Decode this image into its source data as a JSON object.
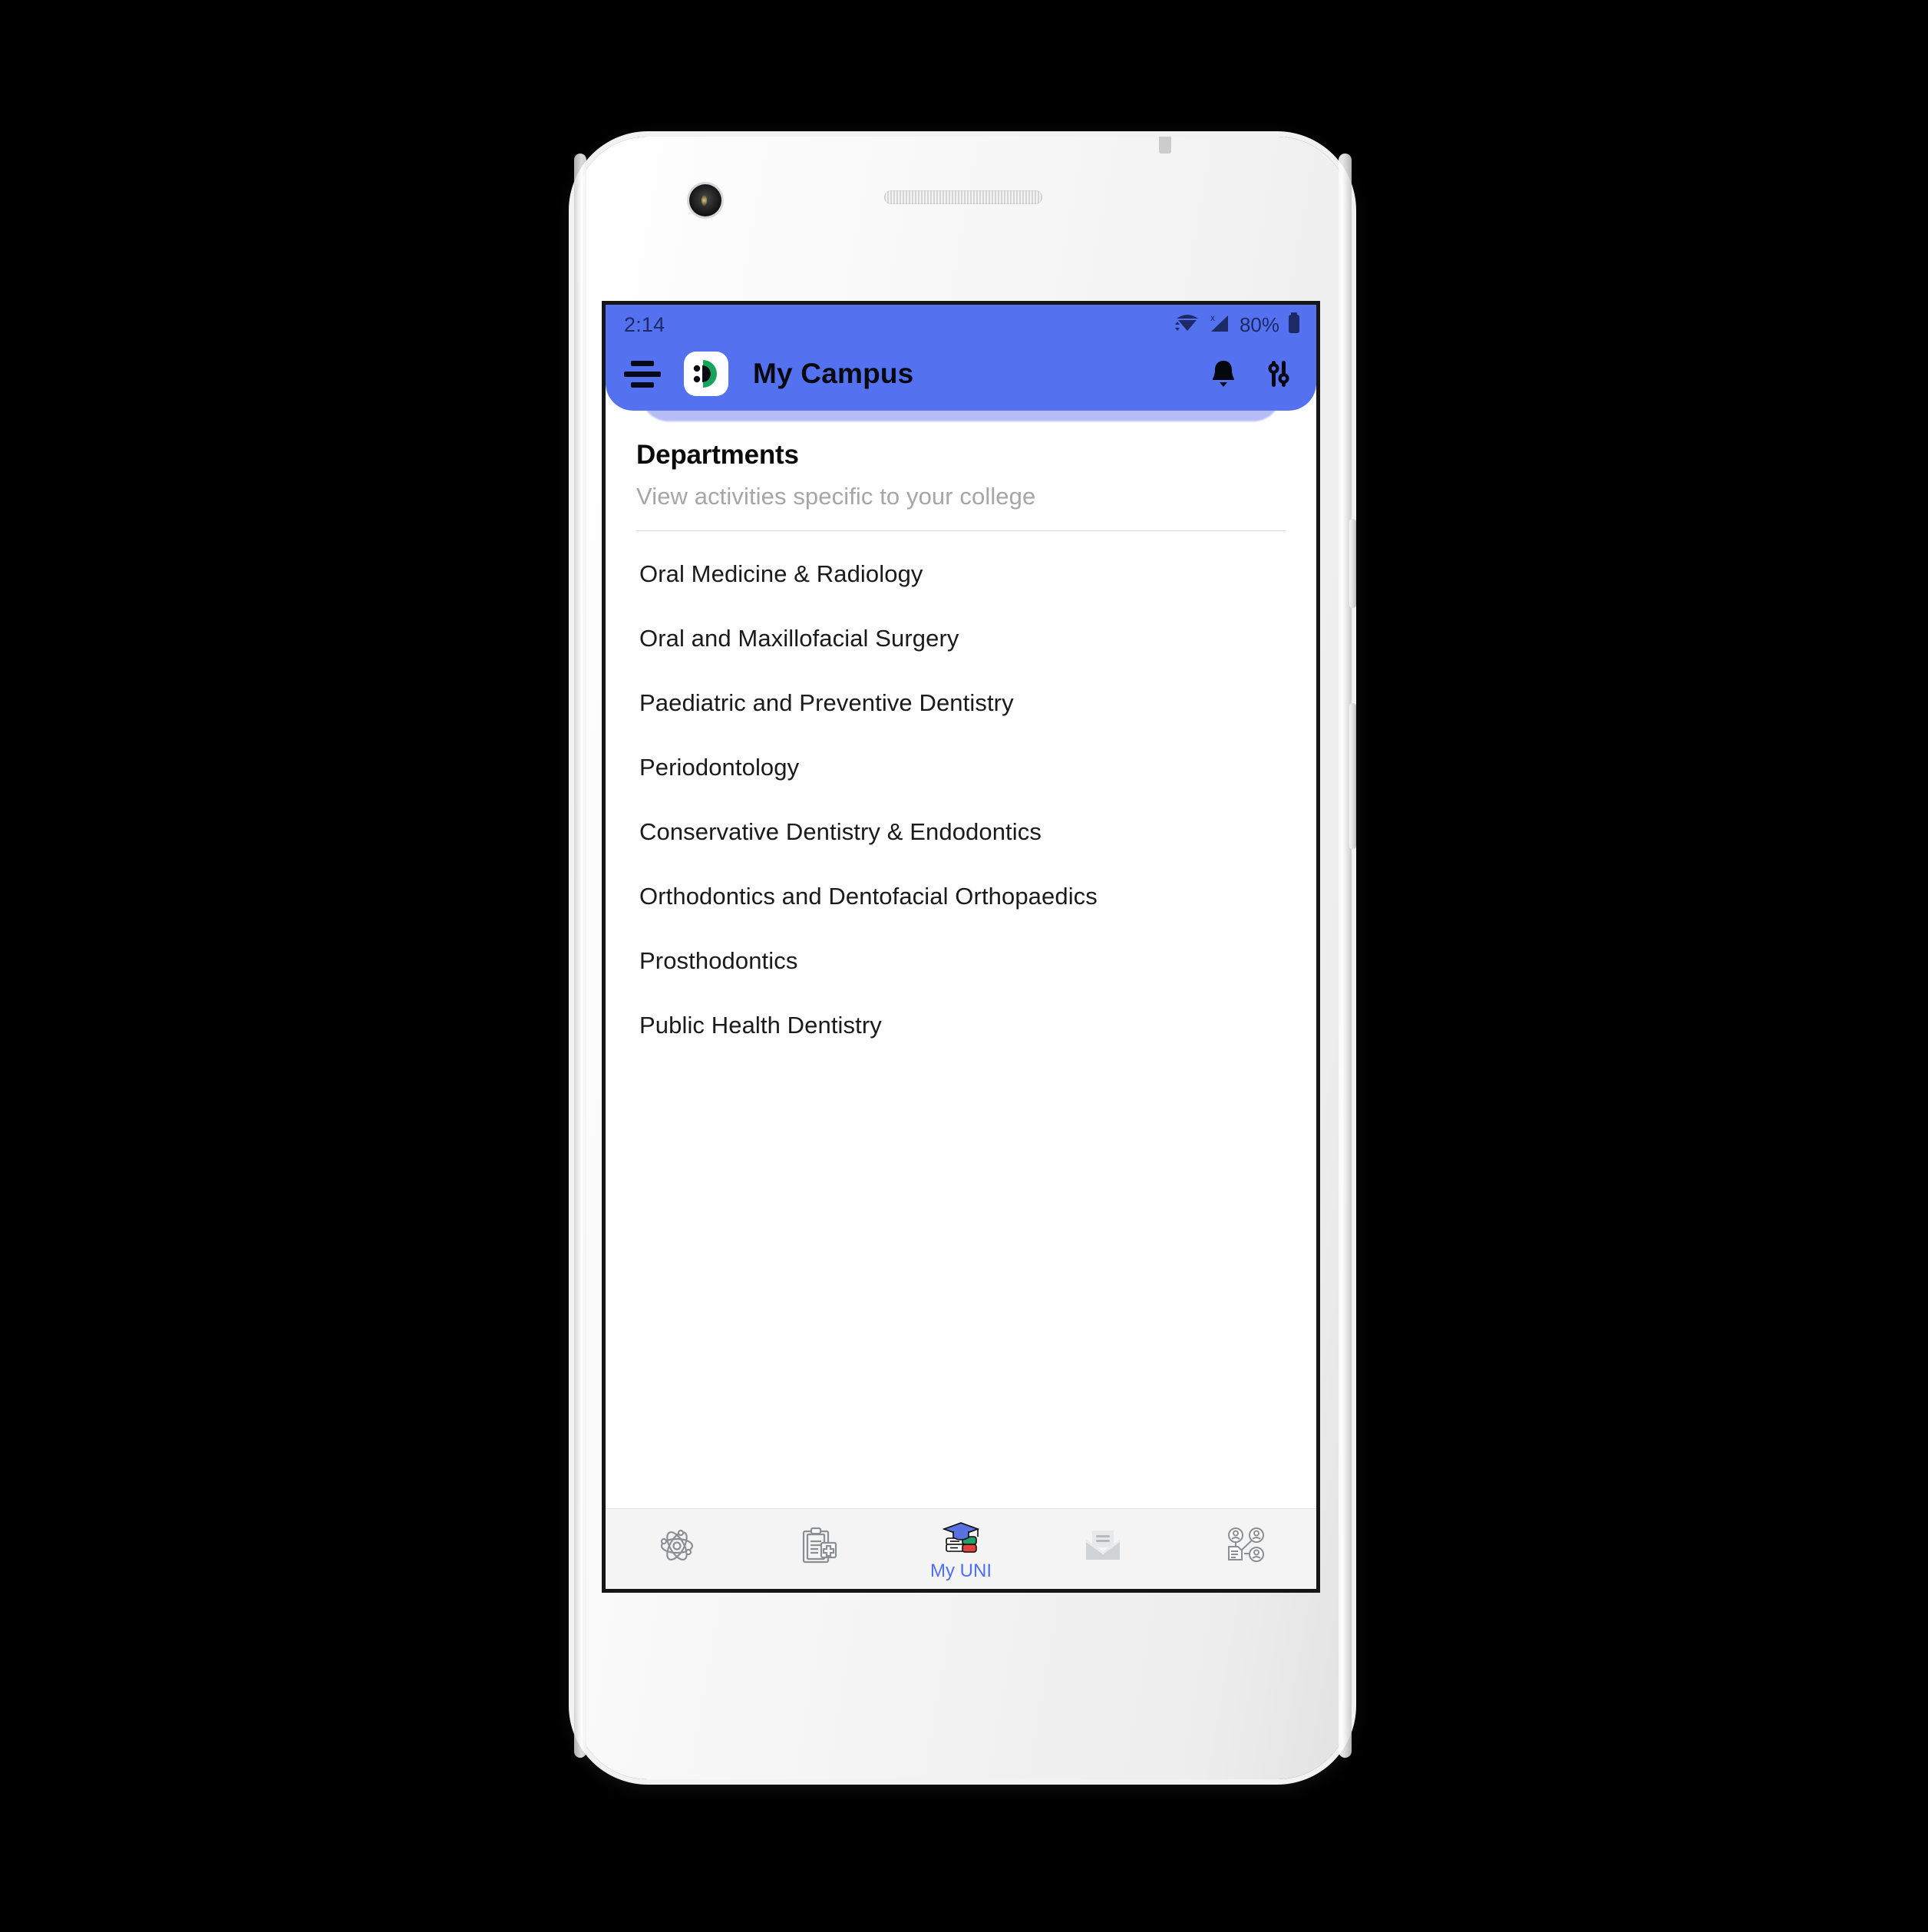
{
  "device": {
    "type": "android-phone-mockup",
    "frame_color": "#f2f2f2"
  },
  "status_bar": {
    "time": "2:14",
    "battery_percent": "80%",
    "wifi_icon": "wifi-icon",
    "signal_icon": "signal-no-sim-icon",
    "battery_icon": "battery-icon",
    "background_color": "#5471f0",
    "text_color": "#1d2a66"
  },
  "app_bar": {
    "menu_icon": "hamburger-menu-icon",
    "logo_icon": "app-logo-icon",
    "title": "My Campus",
    "notifications_icon": "bell-icon",
    "settings_icon": "sliders-icon",
    "background_color": "#5471f0"
  },
  "main": {
    "heading": "Departments",
    "subheading": "View activities specific to your college",
    "departments": [
      "Oral Medicine & Radiology",
      "Oral and Maxillofacial Surgery",
      "Paediatric and Preventive Dentistry",
      "Periodontology",
      "Conservative Dentistry & Endodontics",
      "Orthodontics and Dentofacial Orthopaedics",
      "Prosthodontics",
      "Public Health Dentistry"
    ]
  },
  "bottom_nav": {
    "active_color": "#4f6ff0",
    "items": [
      {
        "icon": "atom-icon",
        "label": ""
      },
      {
        "icon": "medical-clipboard-icon",
        "label": ""
      },
      {
        "icon": "graduation-books-icon",
        "label": "My UNI"
      },
      {
        "icon": "mail-envelope-icon",
        "label": ""
      },
      {
        "icon": "people-network-icon",
        "label": ""
      }
    ]
  }
}
